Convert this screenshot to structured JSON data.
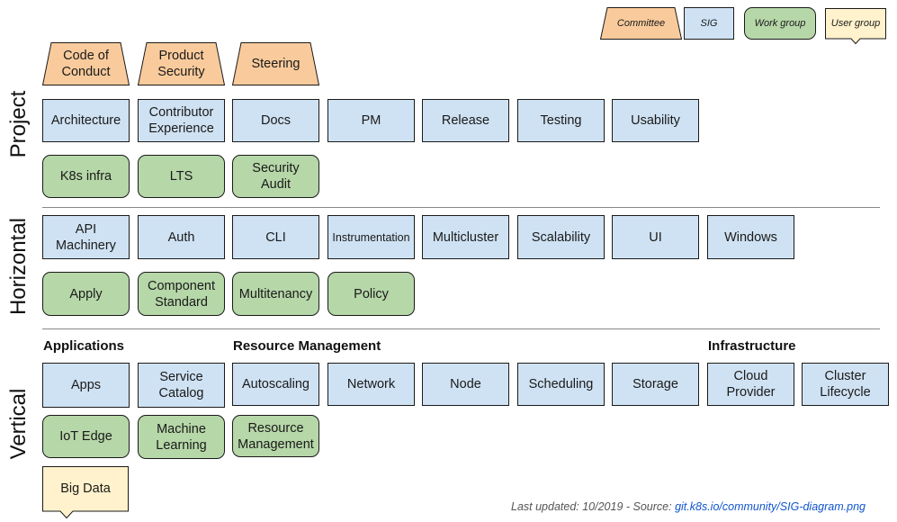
{
  "legend": {
    "committee": "Committee",
    "sig": "SIG",
    "work_group": "Work group",
    "user_group": "User group"
  },
  "colors": {
    "committee": "#f9cb9c",
    "sig": "#cfe2f3",
    "work_group": "#b6d7a8",
    "user_group": "#fff2cc",
    "link": "#1155cc"
  },
  "sections": {
    "project": {
      "label": "Project",
      "committees": [
        "Code of\nConduct",
        "Product\nSecurity",
        "Steering"
      ],
      "sigs": [
        "Architecture",
        "Contributor\nExperience",
        "Docs",
        "PM",
        "Release",
        "Testing",
        "Usability"
      ],
      "work_groups": [
        "K8s infra",
        "LTS",
        "Security\nAudit"
      ]
    },
    "horizontal": {
      "label": "Horizontal",
      "sigs": [
        "API\nMachinery",
        "Auth",
        "CLI",
        "Instrumentation",
        "Multicluster",
        "Scalability",
        "UI",
        "Windows"
      ],
      "work_groups": [
        "Apply",
        "Component\nStandard",
        "Multitenancy",
        "Policy"
      ]
    },
    "vertical": {
      "label": "Vertical",
      "groups": {
        "applications": "Applications",
        "resource_management": "Resource Management",
        "infrastructure": "Infrastructure"
      },
      "sigs": [
        "Apps",
        "Service\nCatalog",
        "Autoscaling",
        "Network",
        "Node",
        "Scheduling",
        "Storage",
        "Cloud\nProvider",
        "Cluster\nLifecycle"
      ],
      "work_groups": [
        "IoT Edge",
        "Machine\nLearning",
        "Resource\nManagement"
      ],
      "user_groups": [
        "Big Data"
      ]
    }
  },
  "footer": {
    "prefix": "Last updated: 10/2019 - Source: ",
    "link_text": "git.k8s.io/community/SIG-diagram.png"
  }
}
